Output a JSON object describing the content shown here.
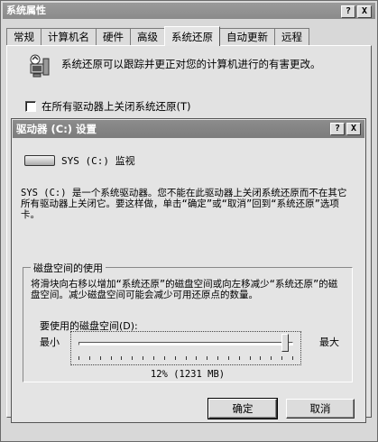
{
  "window": {
    "title": "系统属性",
    "help_btn": "?",
    "close_btn": "X"
  },
  "tabs": [
    {
      "label": "常规"
    },
    {
      "label": "计算机名"
    },
    {
      "label": "硬件"
    },
    {
      "label": "高级"
    },
    {
      "label": "系统还原"
    },
    {
      "label": "自动更新"
    },
    {
      "label": "远程"
    }
  ],
  "restore": {
    "description": "系统还原可以跟踪并更正对您的计算机进行的有害更改。",
    "disable_all_label": "在所有驱动器上关闭系统还原(T)",
    "disable_all_checked": false
  },
  "drive_dialog": {
    "title": "驱动器 (C:) 设置",
    "help_btn": "?",
    "close_btn": "X",
    "drive_label": "SYS (C:)  监视",
    "info_text": "SYS (C:) 是一个系统驱动器。您不能在此驱动器上关闭系统还原而不在其它所有驱动器上关闭它。要这样做，单击“确定”或“取消”回到“系统还原”选项卡。",
    "group_title": "磁盘空间的使用",
    "group_text": "将滑块向右移以增加“系统还原”的磁盘空间或向左移减少“系统还原”的磁盘空间。减少磁盘空间可能会减少可用还原点的数量。",
    "use_label": "要使用的磁盘空间(D):",
    "min_label": "最小",
    "max_label": "最大",
    "slider_fraction": 0.98,
    "usage_text": "12% (1231 MB)",
    "ok_label": "确定",
    "cancel_label": "取消"
  }
}
